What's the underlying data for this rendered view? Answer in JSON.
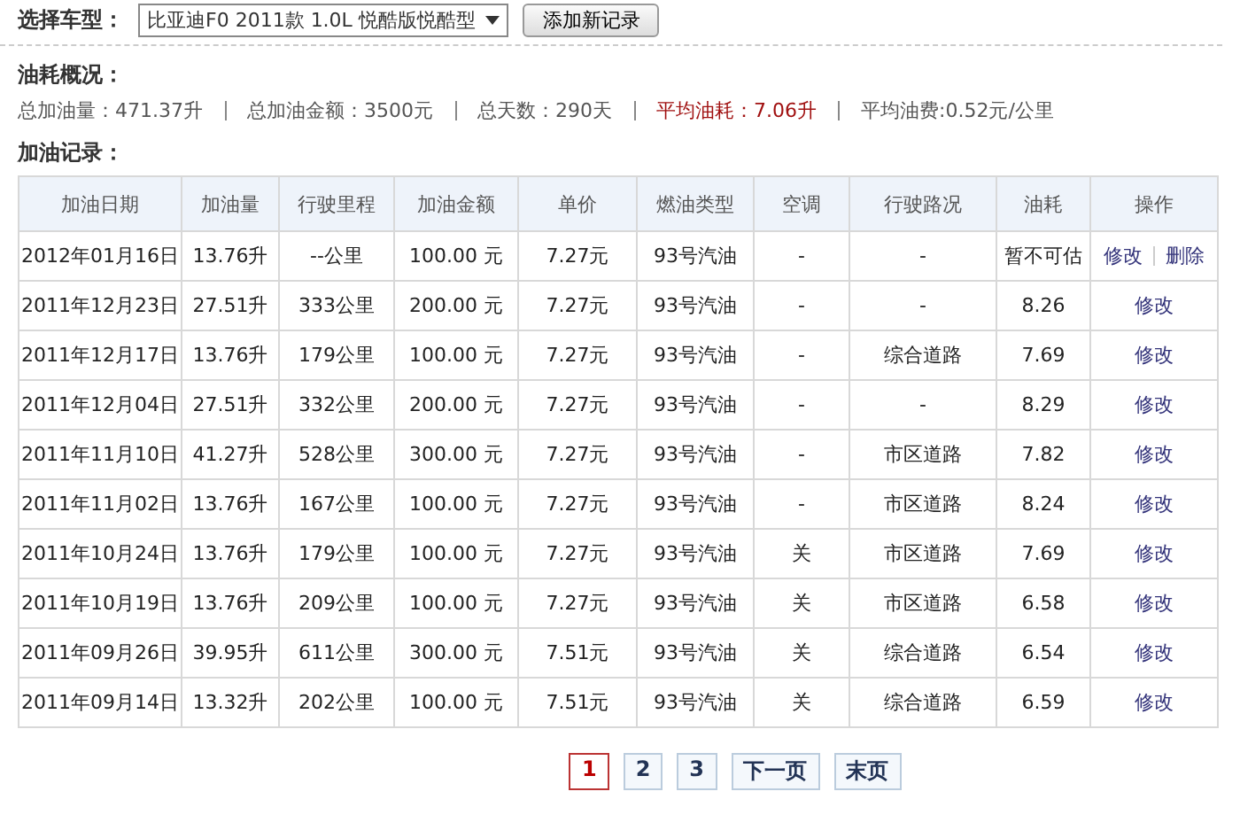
{
  "toolbar": {
    "car_label": "选择车型：",
    "car_select": {
      "value": "比亚迪F0 2011款 1.0L 悦酷版悦酷型"
    },
    "add_button": "添加新记录"
  },
  "summary": {
    "heading": "油耗概况：",
    "items": [
      {
        "text": "总加油量：471.37升",
        "highlighted": false
      },
      {
        "text": "总加油金额：3500元",
        "highlighted": false
      },
      {
        "text": "总天数：290天",
        "highlighted": false
      },
      {
        "text": "平均油耗：7.06升",
        "highlighted": true
      },
      {
        "text": "平均油费:0.52元/公里",
        "highlighted": false
      }
    ]
  },
  "records": {
    "heading": "加油记录：",
    "columns": [
      "加油日期",
      "加油量",
      "行驶里程",
      "加油金额",
      "单价",
      "燃油类型",
      "空调",
      "行驶路况",
      "油耗",
      "操作"
    ],
    "rows": [
      {
        "cells": [
          "2012年01月16日",
          "13.76升",
          "--公里",
          "100.00 元",
          "7.27元",
          "93号汽油",
          "-",
          "-",
          "暂不可估"
        ],
        "actions": [
          "修改",
          "删除"
        ]
      },
      {
        "cells": [
          "2011年12月23日",
          "27.51升",
          "333公里",
          "200.00 元",
          "7.27元",
          "93号汽油",
          "-",
          "-",
          "8.26"
        ],
        "actions": [
          "修改"
        ]
      },
      {
        "cells": [
          "2011年12月17日",
          "13.76升",
          "179公里",
          "100.00 元",
          "7.27元",
          "93号汽油",
          "-",
          "综合道路",
          "7.69"
        ],
        "actions": [
          "修改"
        ]
      },
      {
        "cells": [
          "2011年12月04日",
          "27.51升",
          "332公里",
          "200.00 元",
          "7.27元",
          "93号汽油",
          "-",
          "-",
          "8.29"
        ],
        "actions": [
          "修改"
        ]
      },
      {
        "cells": [
          "2011年11月10日",
          "41.27升",
          "528公里",
          "300.00 元",
          "7.27元",
          "93号汽油",
          "-",
          "市区道路",
          "7.82"
        ],
        "actions": [
          "修改"
        ]
      },
      {
        "cells": [
          "2011年11月02日",
          "13.76升",
          "167公里",
          "100.00 元",
          "7.27元",
          "93号汽油",
          "-",
          "市区道路",
          "8.24"
        ],
        "actions": [
          "修改"
        ]
      },
      {
        "cells": [
          "2011年10月24日",
          "13.76升",
          "179公里",
          "100.00 元",
          "7.27元",
          "93号汽油",
          "关",
          "市区道路",
          "7.69"
        ],
        "actions": [
          "修改"
        ]
      },
      {
        "cells": [
          "2011年10月19日",
          "13.76升",
          "209公里",
          "100.00 元",
          "7.27元",
          "93号汽油",
          "关",
          "市区道路",
          "6.58"
        ],
        "actions": [
          "修改"
        ]
      },
      {
        "cells": [
          "2011年09月26日",
          "39.95升",
          "611公里",
          "300.00 元",
          "7.51元",
          "93号汽油",
          "关",
          "综合道路",
          "6.54"
        ],
        "actions": [
          "修改"
        ]
      },
      {
        "cells": [
          "2011年09月14日",
          "13.32升",
          "202公里",
          "100.00 元",
          "7.51元",
          "93号汽油",
          "关",
          "综合道路",
          "6.59"
        ],
        "actions": [
          "修改"
        ]
      }
    ]
  },
  "pagination": [
    {
      "label": "1",
      "selected": true
    },
    {
      "label": "2",
      "selected": false
    },
    {
      "label": "3",
      "selected": false
    },
    {
      "label": "下一页",
      "selected": false
    },
    {
      "label": "末页",
      "selected": false
    }
  ]
}
